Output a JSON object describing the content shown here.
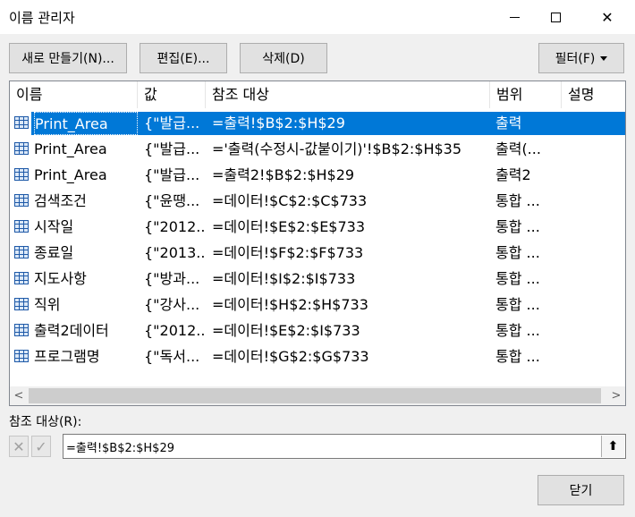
{
  "window": {
    "title": "이름 관리자",
    "close_glyph": "✕"
  },
  "toolbar": {
    "new_label": "새로 만들기(N)...",
    "edit_label": "편집(E)...",
    "delete_label": "삭제(D)",
    "filter_label": "필터(F)"
  },
  "columns": [
    "이름",
    "값",
    "참조 대상",
    "범위",
    "설명"
  ],
  "rows": [
    {
      "name": "Print_Area",
      "value": "{\"발급...",
      "ref": "=출력!$B$2:$H$29",
      "scope": "출력",
      "comment": ""
    },
    {
      "name": "Print_Area",
      "value": "{\"발급...",
      "ref": "='출력(수정시-값붙이기)'!$B$2:$H$35",
      "scope": "출력(...",
      "comment": ""
    },
    {
      "name": "Print_Area",
      "value": "{\"발급...",
      "ref": "=출력2!$B$2:$H$29",
      "scope": "출력2",
      "comment": ""
    },
    {
      "name": "검색조건",
      "value": "{\"윤땡...",
      "ref": "=데이터!$C$2:$C$733",
      "scope": "통합 ...",
      "comment": ""
    },
    {
      "name": "시작일",
      "value": "{\"2012...",
      "ref": "=데이터!$E$2:$E$733",
      "scope": "통합 ...",
      "comment": ""
    },
    {
      "name": "종료일",
      "value": "{\"2013...",
      "ref": "=데이터!$F$2:$F$733",
      "scope": "통합 ...",
      "comment": ""
    },
    {
      "name": "지도사항",
      "value": "{\"방과...",
      "ref": "=데이터!$I$2:$I$733",
      "scope": "통합 ...",
      "comment": ""
    },
    {
      "name": "직위",
      "value": "{\"강사...",
      "ref": "=데이터!$H$2:$H$733",
      "scope": "통합 ...",
      "comment": ""
    },
    {
      "name": "출력2데이터",
      "value": "{\"2012...",
      "ref": "=데이터!$E$2:$I$733",
      "scope": "통합 ...",
      "comment": ""
    },
    {
      "name": "프로그램명",
      "value": "{\"독서...",
      "ref": "=데이터!$G$2:$G$733",
      "scope": "통합 ...",
      "comment": ""
    }
  ],
  "selected_row": 0,
  "scrollbar": {
    "left_arrow": "<",
    "right_arrow": ">"
  },
  "refers_to": {
    "label": "참조 대상(R):",
    "value": "=출력!$B$2:$H$29",
    "cancel_glyph": "✕",
    "ok_glyph": "✓",
    "collapse_glyph": "⬆"
  },
  "footer": {
    "close_label": "닫기"
  }
}
